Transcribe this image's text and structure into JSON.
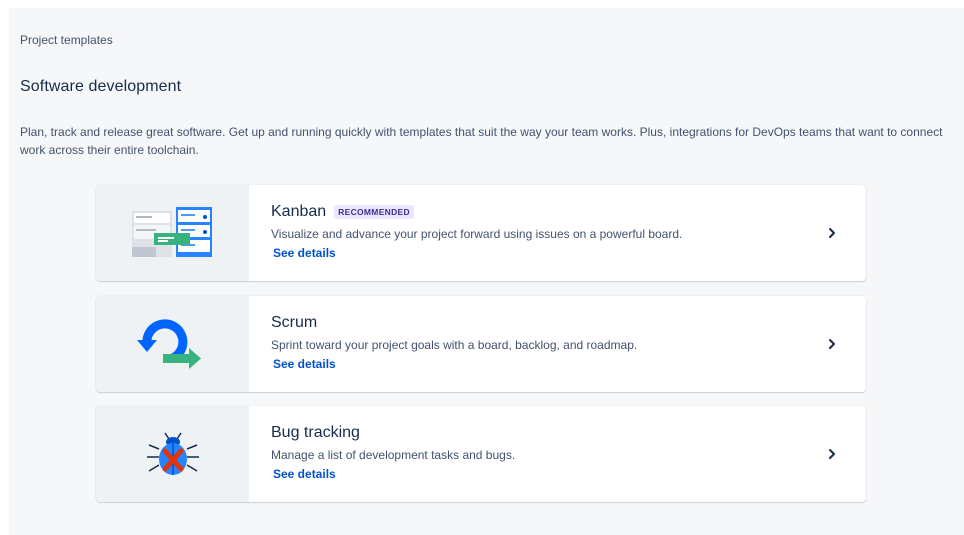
{
  "breadcrumb": "Project templates",
  "section": {
    "title": "Software development",
    "description": "Plan, track and release great software. Get up and running quickly with templates that suit the way your team works. Plus, integrations for DevOps teams that want to connect work across their entire toolchain."
  },
  "templates": [
    {
      "name": "Kanban",
      "badge": "RECOMMENDED",
      "description": "Visualize and advance your project forward using issues on a powerful board.",
      "link": "See details",
      "icon": "kanban-board-icon"
    },
    {
      "name": "Scrum",
      "description": "Sprint toward your project goals with a board, backlog, and roadmap.",
      "link": "See details",
      "icon": "scrum-cycle-icon"
    },
    {
      "name": "Bug tracking",
      "description": "Manage a list of development tasks and bugs.",
      "link": "See details",
      "icon": "bug-icon"
    }
  ],
  "colors": {
    "accent_blue": "#0052cc",
    "badge_bg": "#eae6ff",
    "badge_text": "#403294"
  }
}
